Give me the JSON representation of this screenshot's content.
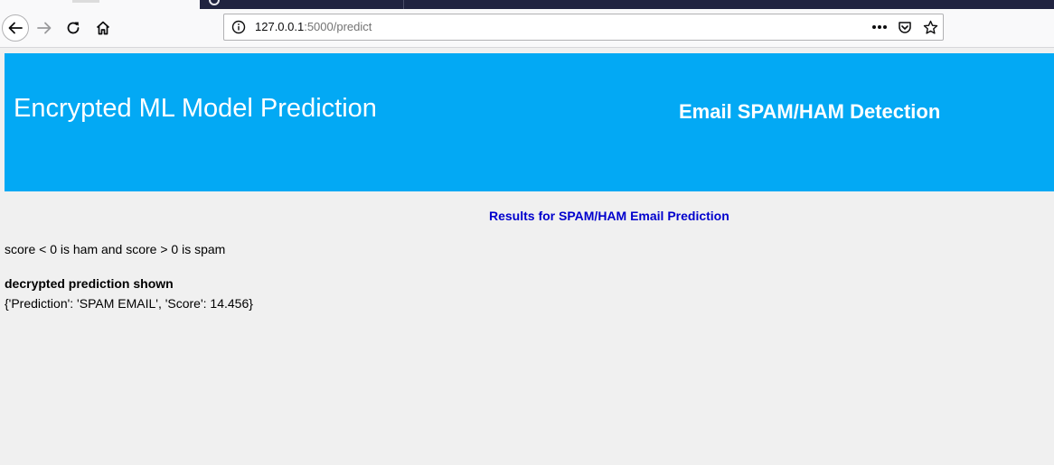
{
  "browser": {
    "url": {
      "host": "127.0.0.1",
      "rest": ":5000/predict"
    }
  },
  "page": {
    "banner": {
      "title": "Encrypted ML Model Prediction",
      "subtitle": "Email SPAM/HAM Detection",
      "background_color": "#03a9f4"
    },
    "results_heading": "Results for SPAM/HAM Email Prediction",
    "results_heading_color": "#0000cd",
    "score_note": "score < 0 is ham and score > 0 is spam",
    "decrypted_label": "decrypted prediction shown",
    "prediction_output": "{'Prediction': 'SPAM EMAIL', 'Score': 14.456}"
  },
  "icons": {
    "back": "back-arrow-icon",
    "forward": "forward-arrow-icon",
    "reload": "reload-icon",
    "home": "home-icon",
    "site_info": "info-icon",
    "page_actions": "ellipsis-icon",
    "pocket": "pocket-icon",
    "bookmark": "star-icon"
  }
}
